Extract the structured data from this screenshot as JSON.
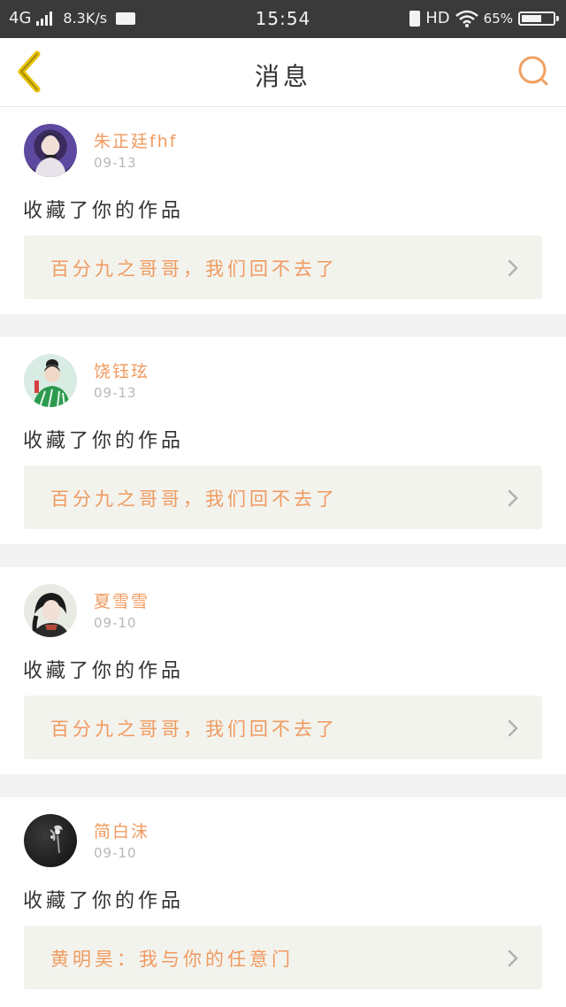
{
  "status_bar": {
    "network": "4G",
    "speed": "8.3K/s",
    "time": "15:54",
    "hd": "HD",
    "battery": "65%",
    "battery_level": 0.65
  },
  "nav": {
    "title": "消息",
    "back_icon": "chevron-left-icon",
    "search_icon": "search-icon",
    "accent_color": "#f0a062",
    "back_color": "#e8c200"
  },
  "messages": [
    {
      "username": "朱正廷fhf",
      "date": "09-13",
      "action": "收藏了你的作品",
      "work_title": "百分九之哥哥，我们回不去了"
    },
    {
      "username": "饶钰玹",
      "date": "09-13",
      "action": "收藏了你的作品",
      "work_title": "百分九之哥哥，我们回不去了"
    },
    {
      "username": "夏雪雪",
      "date": "09-10",
      "action": "收藏了你的作品",
      "work_title": "百分九之哥哥，我们回不去了"
    },
    {
      "username": "简白沫",
      "date": "09-10",
      "action": "收藏了你的作品",
      "work_title": "黄明昊：我与你的任意门"
    }
  ],
  "colors": {
    "username": "#f09a5f",
    "work_title": "#f09a5f",
    "card_box": "#f3f3ee",
    "status_bar": "#3a3a3a"
  }
}
